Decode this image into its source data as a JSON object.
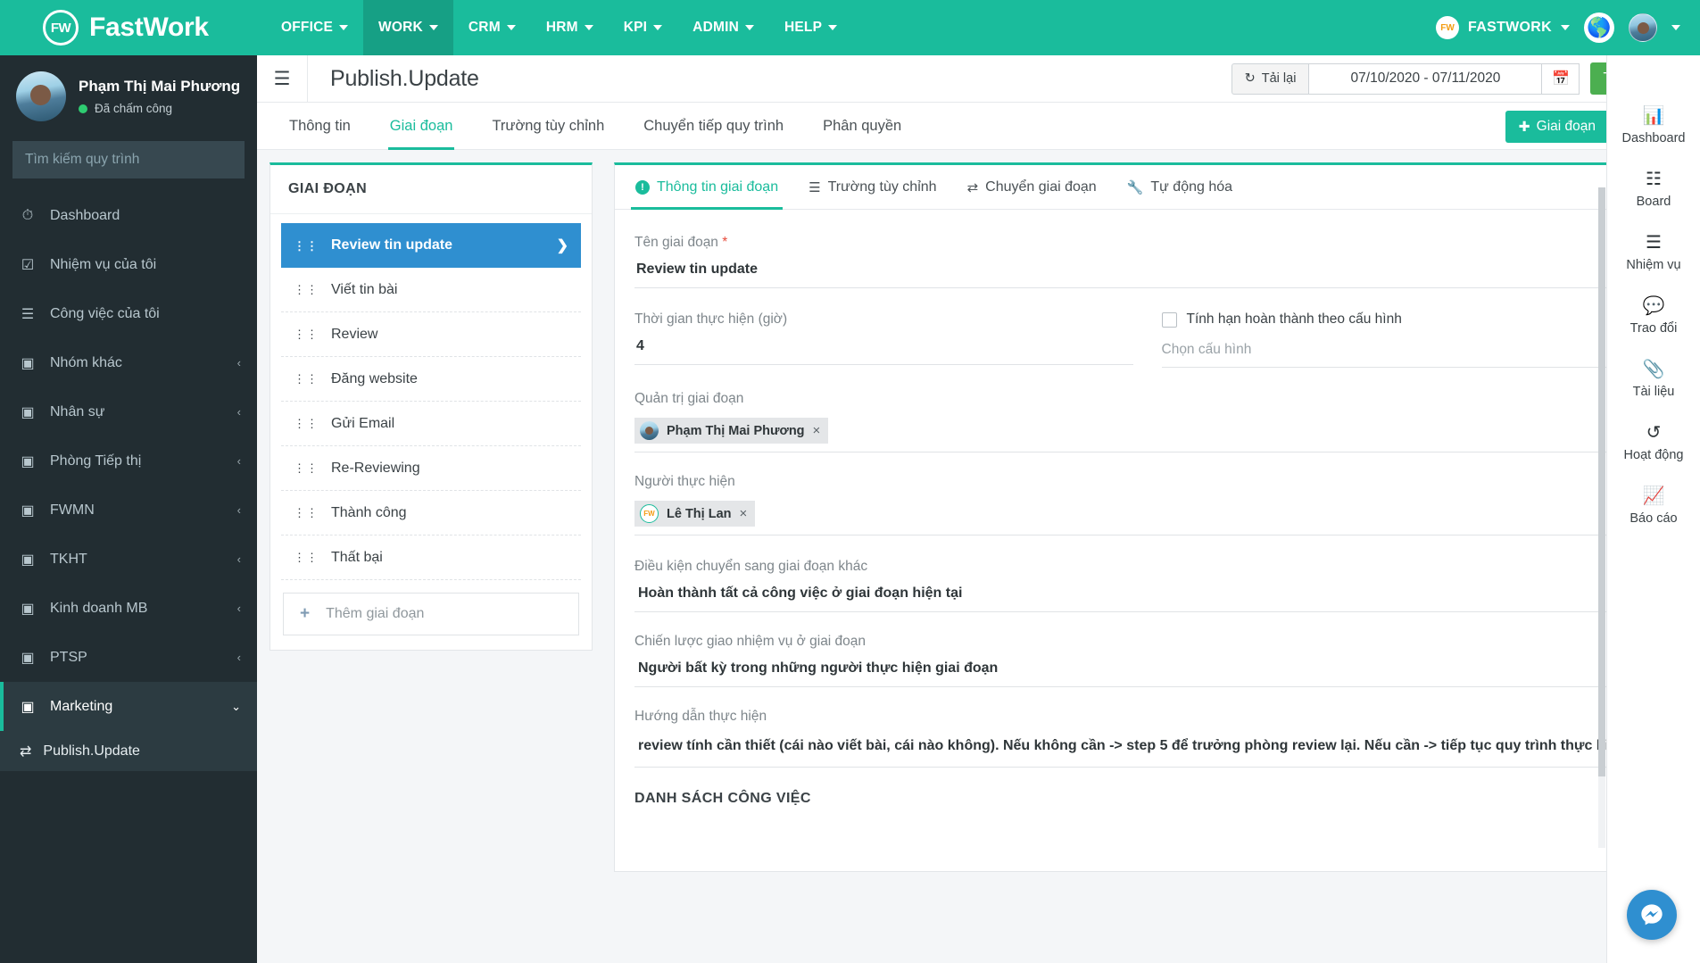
{
  "topbar": {
    "brand": "FastWork",
    "logo_text": "FW",
    "nav": [
      {
        "label": "OFFICE",
        "active": false
      },
      {
        "label": "WORK",
        "active": true
      },
      {
        "label": "CRM",
        "active": false
      },
      {
        "label": "HRM",
        "active": false
      },
      {
        "label": "KPI",
        "active": false
      },
      {
        "label": "ADMIN",
        "active": false
      },
      {
        "label": "HELP",
        "active": false
      }
    ],
    "org_name": "FASTWORK",
    "org_badge": "FW",
    "globe_icon": "globe-icon",
    "accent_color": "#1abc9c",
    "accent_active": "#16a085"
  },
  "sidebar": {
    "user_name": "Phạm Thị Mai Phương",
    "user_status": "Đã chấm công",
    "search_placeholder": "Tìm kiếm quy trình",
    "items": [
      {
        "label": "Dashboard",
        "icon": "dashboard-icon",
        "arrow": "",
        "active": false
      },
      {
        "label": "Nhiệm vụ của tôi",
        "icon": "checkbox-task-icon",
        "arrow": "",
        "active": false
      },
      {
        "label": "Công việc của tôi",
        "icon": "list-work-icon",
        "arrow": "",
        "active": false
      },
      {
        "label": "Nhóm khác",
        "icon": "group-icon",
        "arrow": "‹",
        "active": false
      },
      {
        "label": "Nhân sự",
        "icon": "group-icon",
        "arrow": "‹",
        "active": false
      },
      {
        "label": "Phòng Tiếp thị",
        "icon": "group-icon",
        "arrow": "‹",
        "active": false
      },
      {
        "label": "FWMN",
        "icon": "group-icon",
        "arrow": "‹",
        "active": false
      },
      {
        "label": "TKHT",
        "icon": "group-icon",
        "arrow": "‹",
        "active": false
      },
      {
        "label": "Kinh doanh MB",
        "icon": "group-icon",
        "arrow": "‹",
        "active": false
      },
      {
        "label": "PTSP",
        "icon": "group-icon",
        "arrow": "‹",
        "active": false
      },
      {
        "label": "Marketing",
        "icon": "group-icon",
        "arrow": "⌄",
        "active": true
      }
    ],
    "sub_item": {
      "label": "Publish.Update",
      "icon": "shuffle-icon"
    }
  },
  "header": {
    "menu_icon": "hamburger-icon",
    "title": "Publish.Update",
    "reload_label": "Tải lại",
    "reload_icon": "refresh-icon",
    "date_range": "07/10/2020 - 07/11/2020",
    "calendar_icon": "calendar-icon",
    "utility_label": "Tiện ích",
    "utility_color": "#4caf50"
  },
  "page_tabs": {
    "tabs": [
      {
        "label": "Thông tin",
        "active": false
      },
      {
        "label": "Giai đoạn",
        "active": true
      },
      {
        "label": "Trường tùy chỉnh",
        "active": false
      },
      {
        "label": "Chuyển tiếp quy trình",
        "active": false
      },
      {
        "label": "Phân quyền",
        "active": false
      }
    ],
    "add_button": "Giai đoạn",
    "add_icon": "plus-icon"
  },
  "stage_panel": {
    "title": "GIAI ĐOẠN",
    "stages": [
      {
        "name": "Review tin update",
        "active": true
      },
      {
        "name": "Viết tin bài",
        "active": false
      },
      {
        "name": "Review",
        "active": false
      },
      {
        "name": "Đăng website",
        "active": false
      },
      {
        "name": "Gửi Email",
        "active": false
      },
      {
        "name": "Re-Reviewing",
        "active": false
      },
      {
        "name": "Thành công",
        "active": false
      },
      {
        "name": "Thất bại",
        "active": false
      }
    ],
    "add_stage": "Thêm giai đoạn",
    "active_color": "#2f8fd0"
  },
  "detail": {
    "tabs": [
      {
        "label": "Thông tin giai đoạn",
        "icon": "info-icon",
        "active": true
      },
      {
        "label": "Trường tùy chỉnh",
        "icon": "list-icon",
        "active": false
      },
      {
        "label": "Chuyển giai đoạn",
        "icon": "transfer-icon",
        "active": false
      },
      {
        "label": "Tự động hóa",
        "icon": "wrench-icon",
        "active": false
      }
    ],
    "stage_name_label": "Tên giai đoạn",
    "stage_name_required": "*",
    "stage_name_value": "Review tin update",
    "duration_label": "Thời gian thực hiện (giờ)",
    "duration_value": "4",
    "deadline_checkbox_label": "Tính hạn hoàn thành theo cấu hình",
    "deadline_checked": false,
    "config_placeholder": "Chọn cấu hình",
    "manager_label": "Quản trị giai đoạn",
    "manager_tag": "Phạm Thị Mai Phương",
    "assignee_label": "Người thực hiện",
    "assignee_tag": "Lê Thị Lan",
    "assignee_badge": "FW",
    "condition_label": "Điều kiện chuyển sang giai đoạn khác",
    "condition_value": "Hoàn thành tất cả công việc ở giai đoạn hiện tại",
    "strategy_label": "Chiến lược giao nhiệm vụ ở giai đoạn",
    "strategy_value": "Người bất kỳ trong những người thực hiện giai đoạn",
    "guide_label": "Hướng dẫn thực hiện",
    "guide_value": "review tính cần thiết (cái nào viết bài, cái nào không). Nếu không cần -> step 5 để trưởng phòng review lại. Nếu cần -> tiếp tục quy trình thực hiện",
    "work_list_title": "DANH SÁCH CÔNG VIỆC"
  },
  "right_rail": {
    "items": [
      {
        "label": "Dashboard",
        "icon": "bar-chart-icon"
      },
      {
        "label": "Board",
        "icon": "board-icon"
      },
      {
        "label": "Nhiệm vụ",
        "icon": "list-icon"
      },
      {
        "label": "Trao đổi",
        "icon": "chat-icon"
      },
      {
        "label": "Tài liệu",
        "icon": "paperclip-icon"
      },
      {
        "label": "Hoạt động",
        "icon": "history-icon"
      },
      {
        "label": "Báo cáo",
        "icon": "trend-chart-icon"
      }
    ]
  },
  "chat_widget": {
    "icon": "messenger-icon",
    "color": "#2f8fd0"
  }
}
